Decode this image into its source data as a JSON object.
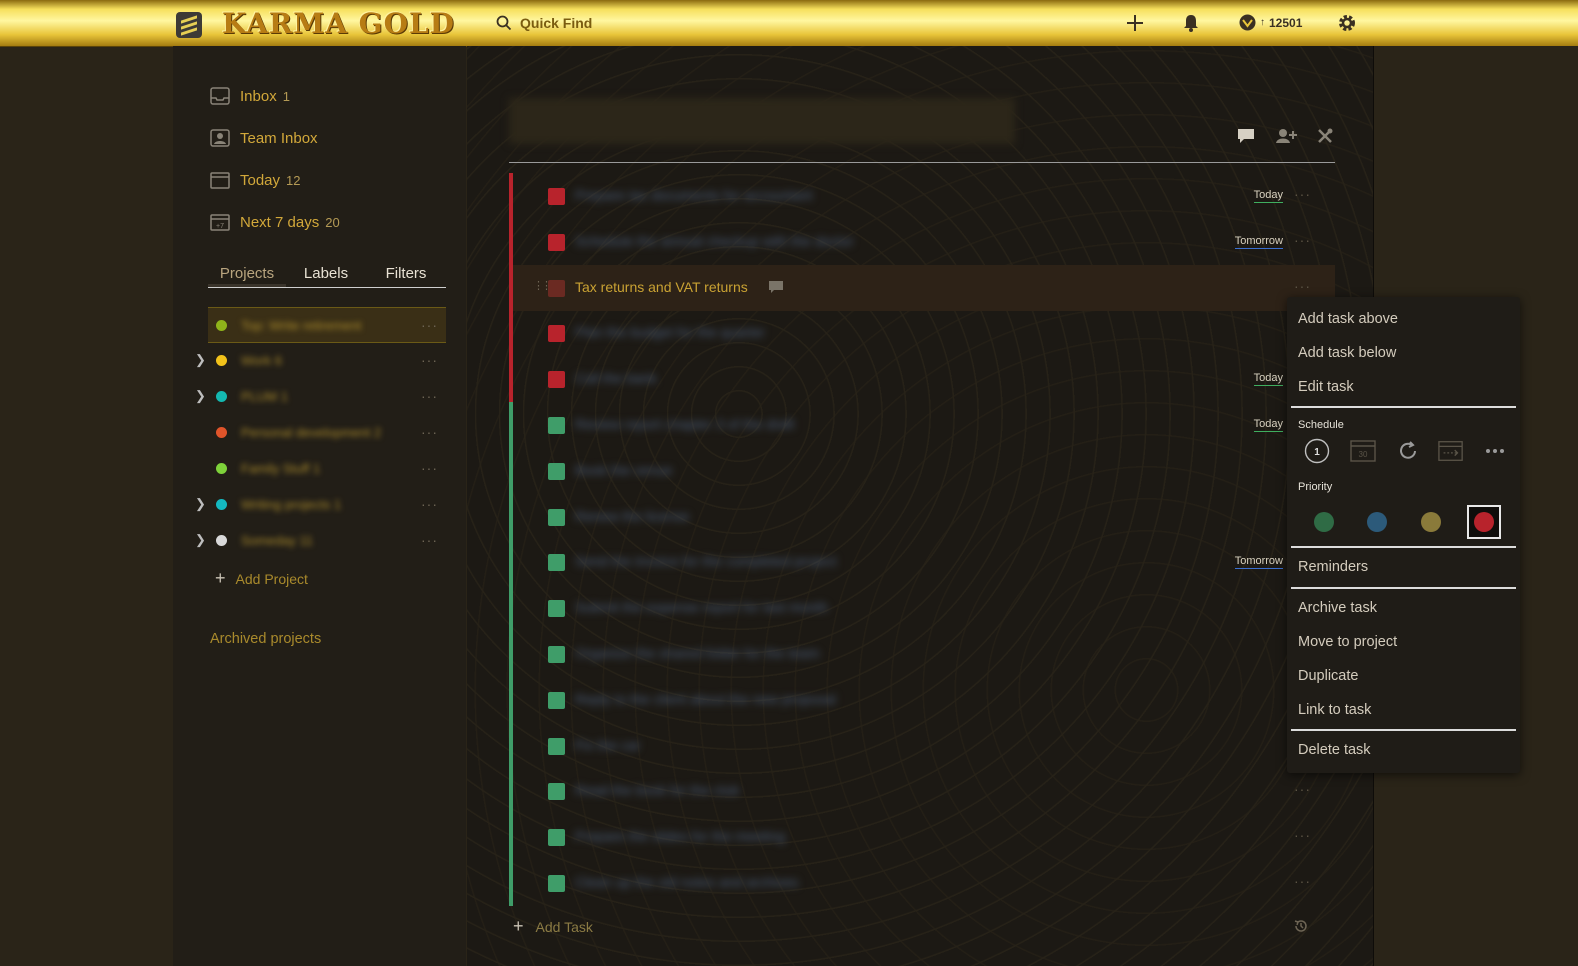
{
  "app": {
    "name": "KARMA GOLD"
  },
  "topbar": {
    "search_placeholder": "Quick Find",
    "karma": "12501",
    "icons": [
      "add-icon",
      "bell-icon",
      "karma-icon",
      "gear-icon"
    ]
  },
  "sidebar": {
    "nav": [
      {
        "label": "Inbox",
        "count": "1",
        "icon": "inbox-icon"
      },
      {
        "label": "Team Inbox",
        "count": "",
        "icon": "team-inbox-icon"
      },
      {
        "label": "Today",
        "count": "12",
        "icon": "calendar-icon"
      },
      {
        "label": "Next 7 days",
        "count": "20",
        "icon": "calendar-week-icon"
      }
    ],
    "tabs": [
      "Projects",
      "Labels",
      "Filters"
    ],
    "projects": [
      {
        "name": "Top: Write retirement",
        "count": "",
        "color": "#8fb31a"
      },
      {
        "name": "Work",
        "count": "6",
        "color": "#f2c21a"
      },
      {
        "name": "PLUM",
        "count": "1",
        "color": "#14b8b0"
      },
      {
        "name": "Personal development",
        "count": "2",
        "color": "#e0542a"
      },
      {
        "name": "Family Stuff",
        "count": "1",
        "color": "#7ed23a"
      },
      {
        "name": "Writing projects",
        "count": "1",
        "color": "#14b8c0"
      },
      {
        "name": "Someday",
        "count": "11",
        "color": "#d9d9d9"
      }
    ],
    "add_project": "Add Project",
    "archived": "Archived projects"
  },
  "main": {
    "tasks": [
      {
        "text": "Prepare tax documents for accountant",
        "due": "Today",
        "due_color": "#3fae5f",
        "priority_color": "#b8232c",
        "blur": true
      },
      {
        "text": "Schedule the annual checkup with the doctor",
        "due": "Tomorrow",
        "due_color": "#3a6fd1",
        "priority_color": "#b8232c",
        "blur": true
      },
      {
        "text": "Tax returns and VAT returns",
        "due": "",
        "due_color": "#3fae5f",
        "priority_color": "#6b2a22",
        "blur": false,
        "highlight": true
      },
      {
        "text": "Plan the budget for the quarter",
        "due": "",
        "due_color": "",
        "priority_color": "#b8232c",
        "blur": true
      },
      {
        "text": "Call the bank",
        "due": "Today",
        "due_color": "#3fae5f",
        "priority_color": "#b8232c",
        "blur": true
      },
      {
        "text": "Review report chapter 3 of the draft",
        "due": "Today",
        "due_color": "#3fae5f",
        "priority_color": "#3f9d69",
        "blur": true
      },
      {
        "text": "Book the venue",
        "due": "",
        "due_color": "",
        "priority_color": "#3f9d69",
        "blur": true
      },
      {
        "text": "Renew the license",
        "due": "",
        "due_color": "",
        "priority_color": "#3f9d69",
        "blur": true
      },
      {
        "text": "Send the invoice for the completed project",
        "due": "Tomorrow",
        "due_color": "#3a6fd1",
        "priority_color": "#3f9d69",
        "blur": true
      },
      {
        "text": "Submit the expense report for last month",
        "due": "",
        "due_color": "",
        "priority_color": "#3f9d69",
        "blur": true
      },
      {
        "text": "Organize the shared folder for the team",
        "due": "",
        "due_color": "",
        "priority_color": "#3f9d69",
        "blur": true
      },
      {
        "text": "Reply to the client about the new proposal",
        "due": "",
        "due_color": "",
        "priority_color": "#3f9d69",
        "blur": true
      },
      {
        "text": "Fix the car",
        "due": "",
        "due_color": "",
        "priority_color": "#3f9d69",
        "blur": true
      },
      {
        "text": "Read the book for the club",
        "due": "",
        "due_color": "",
        "priority_color": "#3f9d69",
        "blur": true
      },
      {
        "text": "Prepare the slides for the meeting",
        "due": "",
        "due_color": "",
        "priority_color": "#3f9d69",
        "blur": true
      },
      {
        "text": "Clean up the old notes and archives",
        "due": "",
        "due_color": "",
        "priority_color": "#3f9d69",
        "blur": true
      }
    ],
    "add_task": "Add Task"
  },
  "context_menu": {
    "items_top": [
      "Add task above",
      "Add task below",
      "Edit task"
    ],
    "schedule_label": "Schedule",
    "schedule_icons": [
      "today-icon",
      "tomorrow-icon",
      "next-week-icon",
      "postpone-icon",
      "more-icon"
    ],
    "schedule_today_num": "1",
    "schedule_tomorrow_num": "30",
    "priority_label": "Priority",
    "priorities": [
      {
        "color": "#2f6b45",
        "selected": false
      },
      {
        "color": "#2c5a7a",
        "selected": false
      },
      {
        "color": "#8a7a3a",
        "selected": false
      },
      {
        "color": "#b8232c",
        "selected": true
      }
    ],
    "reminders": "Reminders",
    "items_mid": [
      "Archive task",
      "Move to project",
      "Duplicate",
      "Link to task"
    ],
    "delete": "Delete task"
  }
}
